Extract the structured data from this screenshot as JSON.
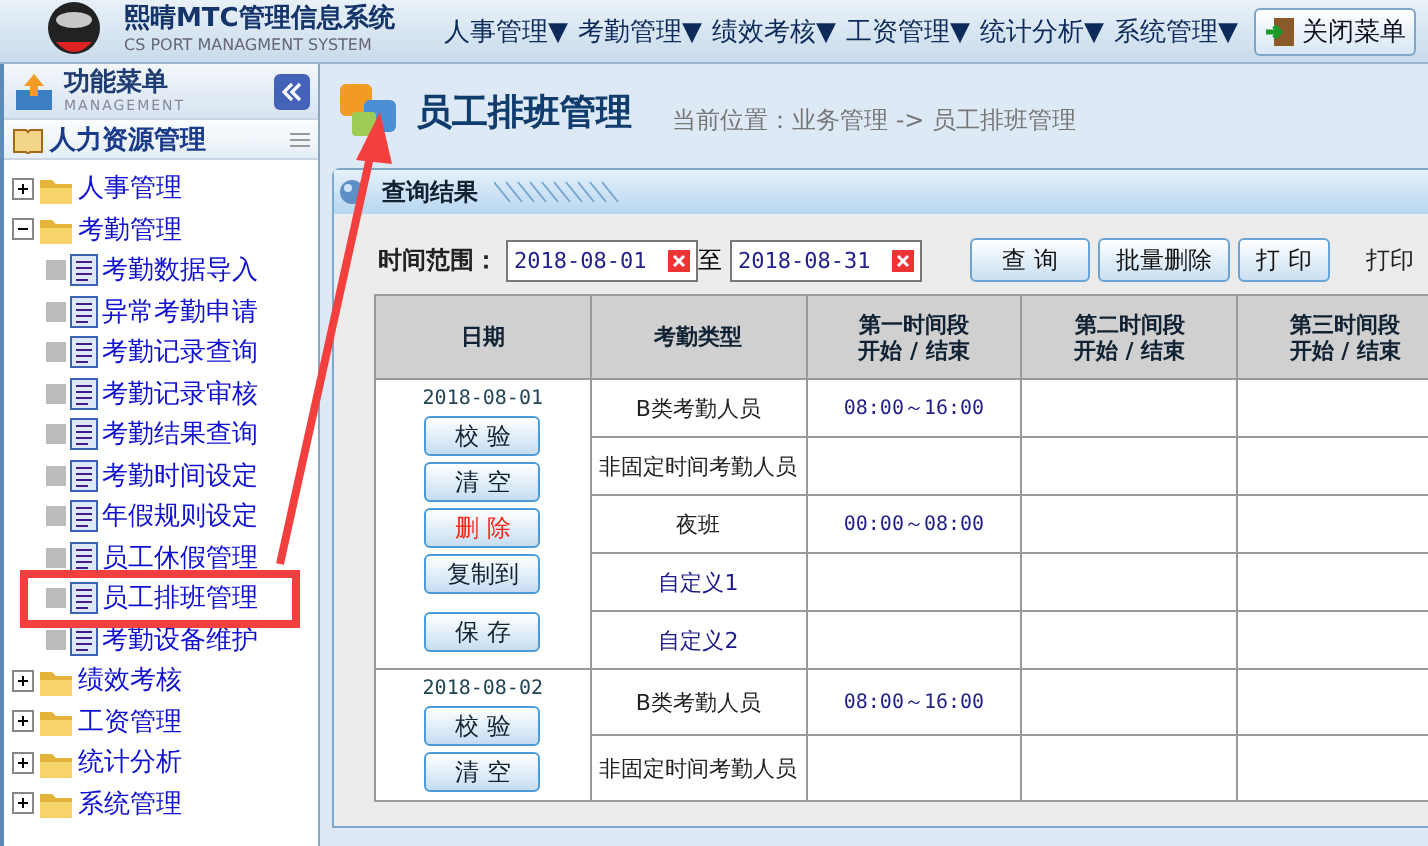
{
  "app": {
    "title": "熙晴MTC管理信息系统",
    "subtitle": "CS PORT MANAGMENT SYSTEM"
  },
  "top_menu": [
    {
      "label": "人事管理▼"
    },
    {
      "label": "考勤管理▼"
    },
    {
      "label": "绩效考核▼"
    },
    {
      "label": "工资管理▼"
    },
    {
      "label": "统计分析▼"
    },
    {
      "label": "系统管理▼"
    }
  ],
  "close_menu_button": "关闭菜单",
  "sidebar": {
    "title": "功能菜单",
    "subtitle": "MANAGEMENT",
    "section": "人力资源管理",
    "items": [
      {
        "label": "人事管理",
        "expanded": false
      },
      {
        "label": "考勤管理",
        "expanded": true,
        "children": [
          {
            "label": "考勤数据导入",
            "selected": false
          },
          {
            "label": "异常考勤申请",
            "selected": false
          },
          {
            "label": "考勤记录查询",
            "selected": false
          },
          {
            "label": "考勤记录审核",
            "selected": false
          },
          {
            "label": "考勤结果查询",
            "selected": false
          },
          {
            "label": "考勤时间设定",
            "selected": false
          },
          {
            "label": "年假规则设定",
            "selected": false
          },
          {
            "label": "员工休假管理",
            "selected": false
          },
          {
            "label": "员工排班管理",
            "selected": true
          },
          {
            "label": "考勤设备维护",
            "selected": false
          }
        ]
      },
      {
        "label": "绩效考核",
        "expanded": false
      },
      {
        "label": "工资管理",
        "expanded": false
      },
      {
        "label": "统计分析",
        "expanded": false
      },
      {
        "label": "系统管理",
        "expanded": false
      }
    ]
  },
  "page": {
    "title": "员工排班管理",
    "breadcrumb": "当前位置：业务管理 -> 员工排班管理"
  },
  "panel": {
    "title": "查询结果",
    "filter": {
      "label": "时间范围：",
      "from": "2018-08-01",
      "separator": "至",
      "to": "2018-08-31"
    },
    "buttons": [
      "查 询",
      "批量删除",
      "打 印"
    ],
    "trailing_label": "打印"
  },
  "table": {
    "columns": [
      {
        "lines": [
          "日期"
        ]
      },
      {
        "lines": [
          "考勤类型"
        ]
      },
      {
        "lines": [
          "第一时间段",
          "开始 / 结束"
        ]
      },
      {
        "lines": [
          "第二时间段",
          "开始 / 结束"
        ]
      },
      {
        "lines": [
          "第三时间段",
          "开始 / 结束"
        ]
      }
    ],
    "groups": [
      {
        "date": "2018-08-01",
        "actions": [
          {
            "label": "校 验",
            "kind": "normal"
          },
          {
            "label": "清 空",
            "kind": "normal"
          },
          {
            "label": "删 除",
            "kind": "danger"
          },
          {
            "label": "复制到",
            "kind": "normal"
          },
          {
            "label": "保 存",
            "kind": "save"
          }
        ],
        "rows": [
          {
            "type": "B类考勤人员",
            "custom": false,
            "slots": [
              "08:00～16:00"
            ]
          },
          {
            "type": "非固定时间考勤人员",
            "custom": false
          },
          {
            "type": "夜班",
            "custom": false,
            "slots": [
              "00:00～08:00"
            ]
          },
          {
            "type": "自定义1",
            "custom": true
          },
          {
            "type": "自定义2",
            "custom": true
          }
        ]
      },
      {
        "date": "2018-08-02",
        "actions": [
          {
            "label": "校 验",
            "kind": "normal"
          },
          {
            "label": "清 空",
            "kind": "normal"
          }
        ],
        "rows": [
          {
            "type": "B类考勤人员",
            "custom": false,
            "slots": [
              "08:00～16:00"
            ]
          },
          {
            "type": "非固定时间考勤人员",
            "custom": false
          }
        ]
      }
    ]
  }
}
